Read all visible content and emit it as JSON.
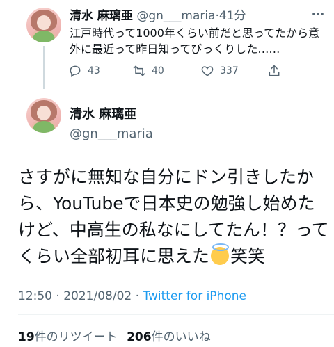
{
  "reply_tweet": {
    "display_name": "清水 麻璃亜",
    "handle": "@gn___maria",
    "separator": "·",
    "time_ago": "41分",
    "text": "江戸時代って1000年くらい前だと思ってたから意外に最近って昨日知ってびっくりした……",
    "replies": "43",
    "retweets": "40",
    "likes": "337"
  },
  "main_tweet": {
    "display_name": "清水 麻璃亜",
    "handle": "@gn___maria",
    "text_before_emoji": "さすがに無知な自分にドン引きしたから、YouTubeで日本史の勉強し始めたけど、中高生の私なにしてたん！？ってくらい全部初耳に思えた",
    "text_after_emoji": "笑笑",
    "time": "12:50",
    "dot": "·",
    "date": "2021/08/02",
    "source": "Twitter for iPhone"
  },
  "stats": {
    "retweet_count": "19",
    "retweet_label": "件のリツイート",
    "like_count": "206",
    "like_label": "件のいいね"
  },
  "icons": {
    "reply": "reply-icon",
    "retweet": "retweet-icon",
    "like": "heart-icon",
    "share": "share-icon",
    "more": "more-icon",
    "emoji": "smiling-face-with-halo-emoji"
  },
  "colors": {
    "text": "#0f1419",
    "muted": "#536471",
    "link": "#1d9bf0"
  }
}
